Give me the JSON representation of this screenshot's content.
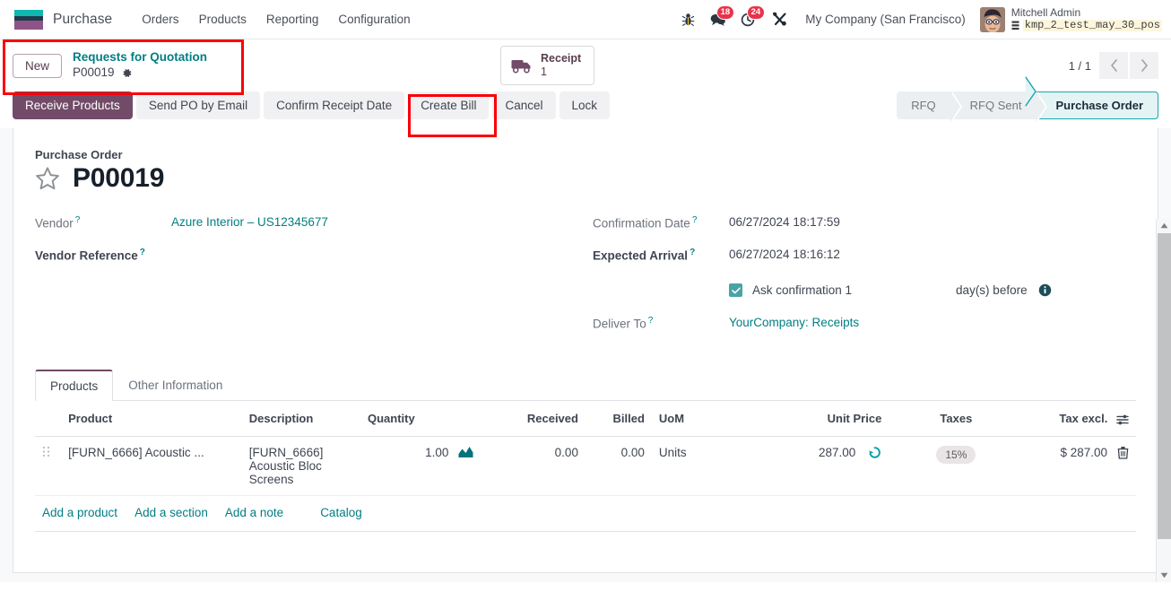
{
  "navbar": {
    "brand": "Purchase",
    "menu": [
      "Orders",
      "Products",
      "Reporting",
      "Configuration"
    ],
    "icons": {
      "bug": "bug-icon",
      "messages": "chat-icon",
      "activities": "clock-icon",
      "tools": "tools-icon"
    },
    "messages_count": "18",
    "activities_count": "24",
    "company": "My Company (San Francisco)",
    "user_name": "Mitchell Admin",
    "database": "kmp_2_test_may_30_pos"
  },
  "control_panel": {
    "new_label": "New",
    "breadcrumb_parent": "Requests for Quotation",
    "breadcrumb_current": "P00019",
    "settings_icon": "gear-icon",
    "smart_button": {
      "icon": "truck-icon",
      "label": "Receipt",
      "value": "1"
    },
    "pager": {
      "count": "1 / 1",
      "previous_icon": "chevron-left-icon",
      "next_icon": "chevron-right-icon"
    },
    "buttons": [
      {
        "label": "Receive Products",
        "primary": true
      },
      {
        "label": "Send PO by Email",
        "primary": false
      },
      {
        "label": "Confirm Receipt Date",
        "primary": false
      },
      {
        "label": "Create Bill",
        "primary": false
      },
      {
        "label": "Cancel",
        "primary": false
      },
      {
        "label": "Lock",
        "primary": false
      }
    ],
    "statusbar": [
      {
        "label": "RFQ",
        "active": false
      },
      {
        "label": "RFQ Sent",
        "active": false
      },
      {
        "label": "Purchase Order",
        "active": true
      }
    ]
  },
  "highlights": {
    "accent_color": "#fb0007",
    "boxes": [
      "breadcrumb-area",
      "create-bill-button"
    ]
  },
  "form": {
    "record_type": "Purchase Order",
    "title": "P00019",
    "star_icon": "star-outline-icon",
    "left_fields": [
      {
        "label": "Vendor",
        "help": "?",
        "value": "Azure Interior – US12345677",
        "is_link": true
      },
      {
        "label": "Vendor Reference",
        "help": "?",
        "value": "",
        "is_link": false
      }
    ],
    "right_fields": [
      {
        "label": "Confirmation Date",
        "help": "?",
        "value": "06/27/2024 18:17:59",
        "bold": false,
        "is_link": false
      },
      {
        "label": "Expected Arrival",
        "help": "?",
        "value": "06/27/2024 18:16:12",
        "bold": true,
        "is_link": false
      }
    ],
    "confirmation": {
      "checked": true,
      "text": "Ask confirmation 1",
      "suffix": "day(s) before",
      "info_icon": "info-icon"
    },
    "deliver_to": {
      "label": "Deliver To",
      "help": "?",
      "value": "YourCompany: Receipts"
    }
  },
  "notebook": {
    "tabs": [
      {
        "label": "Products",
        "active": true
      },
      {
        "label": "Other Information",
        "active": false
      }
    ]
  },
  "lines_table": {
    "columns": [
      "Product",
      "Description",
      "Quantity",
      "Received",
      "Billed",
      "UoM",
      "Unit Price",
      "Taxes",
      "Tax excl."
    ],
    "optional_columns_icon": "column-settings-icon",
    "rows": [
      {
        "handle_icon": "drag-handle-icon",
        "product": "[FURN_6666] Acoustic ...",
        "description": "[FURN_6666] Acoustic Bloc Screens",
        "quantity": "1.00",
        "forecast_icon": "area-chart-icon",
        "received": "0.00",
        "billed": "0.00",
        "uom": "Units",
        "unit_price": "287.00",
        "price_history_icon": "history-icon",
        "taxes": "15%",
        "tax_excl": "$ 287.00",
        "delete_icon": "trash-icon"
      }
    ]
  },
  "footer_links": [
    {
      "label": "Add a product"
    },
    {
      "label": "Add a section"
    },
    {
      "label": "Add a note"
    },
    {
      "label": "Catalog"
    }
  ],
  "scrollbar": {
    "up_icon": "caret-up-icon",
    "down_icon": "caret-down-icon"
  }
}
